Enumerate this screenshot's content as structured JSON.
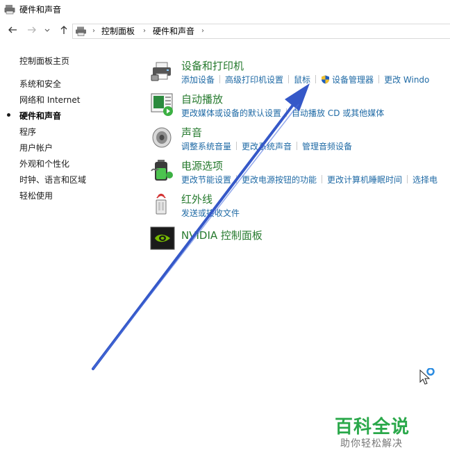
{
  "window": {
    "title": "硬件和声音"
  },
  "nav": {
    "back_icon": "back-arrow-icon",
    "forward_icon": "forward-arrow-icon",
    "recent_icon": "chevron-down-icon",
    "up_icon": "up-arrow-icon",
    "breadcrumbs": [
      "控制面板",
      "硬件和声音"
    ]
  },
  "sidebar": {
    "items": [
      {
        "label": "控制面板主页"
      },
      {
        "label": "系统和安全"
      },
      {
        "label": "网络和 Internet"
      },
      {
        "label": "硬件和声音",
        "active": true
      },
      {
        "label": "程序"
      },
      {
        "label": "用户帐户"
      },
      {
        "label": "外观和个性化"
      },
      {
        "label": "时钟、语言和区域"
      },
      {
        "label": "轻松使用"
      }
    ]
  },
  "categories": [
    {
      "title": "设备和打印机",
      "icon": "printer-icon",
      "links": [
        "添加设备",
        "高级打印机设置",
        "鼠标",
        "设备管理器",
        "更改 Windo"
      ]
    },
    {
      "title": "自动播放",
      "icon": "autoplay-icon",
      "links": [
        "更改媒体或设备的默认设置",
        "自动播放 CD 或其他媒体"
      ]
    },
    {
      "title": "声音",
      "icon": "speaker-icon",
      "links": [
        "调整系统音量",
        "更改系统声音",
        "管理音频设备"
      ]
    },
    {
      "title": "电源选项",
      "icon": "battery-icon",
      "links": [
        "更改节能设置",
        "更改电源按钮的功能",
        "更改计算机睡眠时间",
        "选择电"
      ]
    },
    {
      "title": "红外线",
      "icon": "infrared-icon",
      "links": [
        "发送或接收文件"
      ]
    },
    {
      "title": "NVIDIA 控制面板",
      "icon": "nvidia-icon",
      "links": []
    }
  ],
  "watermark": {
    "title": "百科全说",
    "subtitle": "助你轻松解决"
  },
  "colors": {
    "category_title": "#267a2e",
    "link": "#1f6aa5",
    "annotation_arrow": "#3558c8",
    "watermark_green": "#2aa84a"
  }
}
